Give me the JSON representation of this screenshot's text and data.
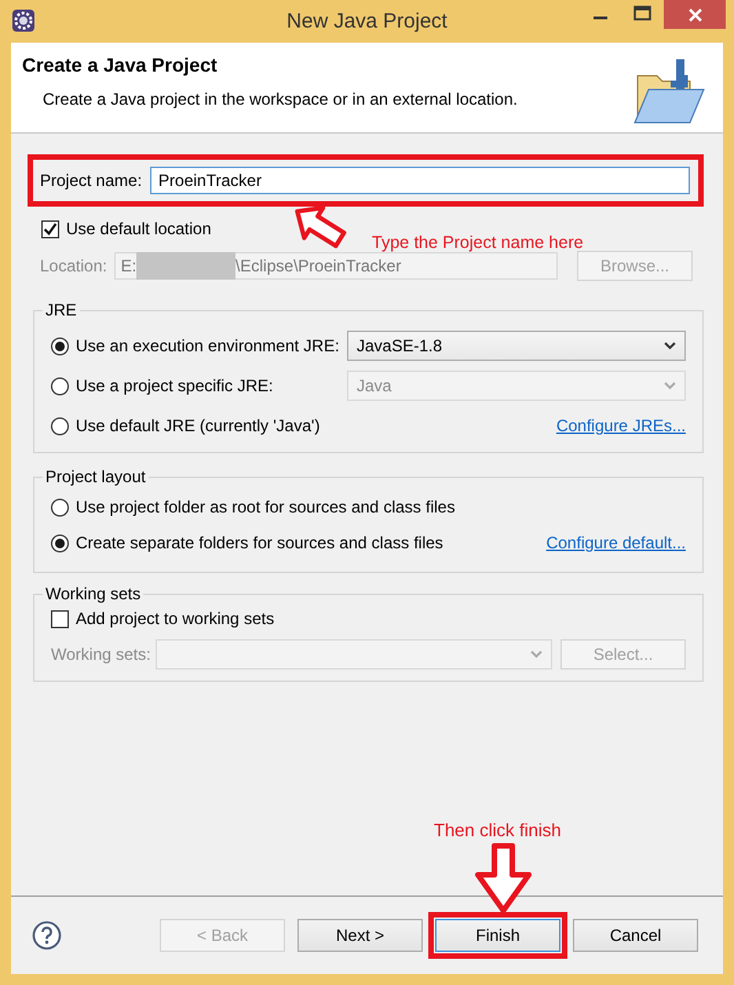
{
  "window": {
    "title": "New Java Project"
  },
  "header": {
    "title": "Create a Java Project",
    "description": "Create a Java project in the workspace or in an external location."
  },
  "project_name": {
    "label": "Project name:",
    "value": "ProeinTracker",
    "focused": true,
    "highlighted": true
  },
  "use_default_location": {
    "label": "Use default location",
    "checked": true
  },
  "location": {
    "label": "Location:",
    "value_start": "E:",
    "redacted": true,
    "value_end": "\\Eclipse\\ProeinTracker",
    "disabled": true,
    "button": "Browse..."
  },
  "jre": {
    "title": "JRE",
    "options": [
      {
        "label": "Use an execution environment JRE:",
        "selected": true,
        "kind": "select",
        "value": "JavaSE-1.8",
        "disabled": false
      },
      {
        "label": "Use a project specific JRE:",
        "selected": false,
        "kind": "select",
        "value": "Java",
        "disabled": true
      },
      {
        "label": "Use default JRE (currently 'Java')",
        "selected": false,
        "kind": "link",
        "link": "Configure JREs..."
      }
    ]
  },
  "project_layout": {
    "title": "Project layout",
    "options": [
      {
        "label": "Use project folder as root for sources and class files",
        "selected": false,
        "kind": "plain"
      },
      {
        "label": "Create separate folders for sources and class files",
        "selected": true,
        "kind": "link",
        "link": "Configure default..."
      }
    ]
  },
  "working_sets": {
    "title": "Working sets",
    "checkbox": {
      "label": "Add project to working sets",
      "checked": false
    },
    "field": {
      "label": "Working sets:",
      "disabled": true
    },
    "button": "Select..."
  },
  "buttons": [
    {
      "label": "< Back",
      "disabled": true,
      "highlighted": false
    },
    {
      "label": "Next >",
      "disabled": false,
      "highlighted": false
    },
    {
      "label": "Finish",
      "disabled": false,
      "highlighted": true
    },
    {
      "label": "Cancel",
      "disabled": false,
      "highlighted": false
    }
  ],
  "annotations": [
    {
      "text": "Type the Project name here",
      "kind": "up-left"
    },
    {
      "text": "Then click finish",
      "kind": "down"
    }
  ]
}
